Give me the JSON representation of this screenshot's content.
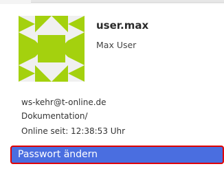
{
  "user": {
    "username": "user.max",
    "full_name": "Max User",
    "avatar_icon": "identicon-avatar",
    "avatar_color": "#a4d10e",
    "email": "ws-kehr@t-online.de",
    "folder": "Dokumentation/",
    "online_status": "Online seit: 12:38:53 Uhr"
  },
  "actions": {
    "change_password_label": "Passwort ändern"
  },
  "colors": {
    "button_background": "#4a6ee0",
    "highlight_outline": "#e00000"
  }
}
